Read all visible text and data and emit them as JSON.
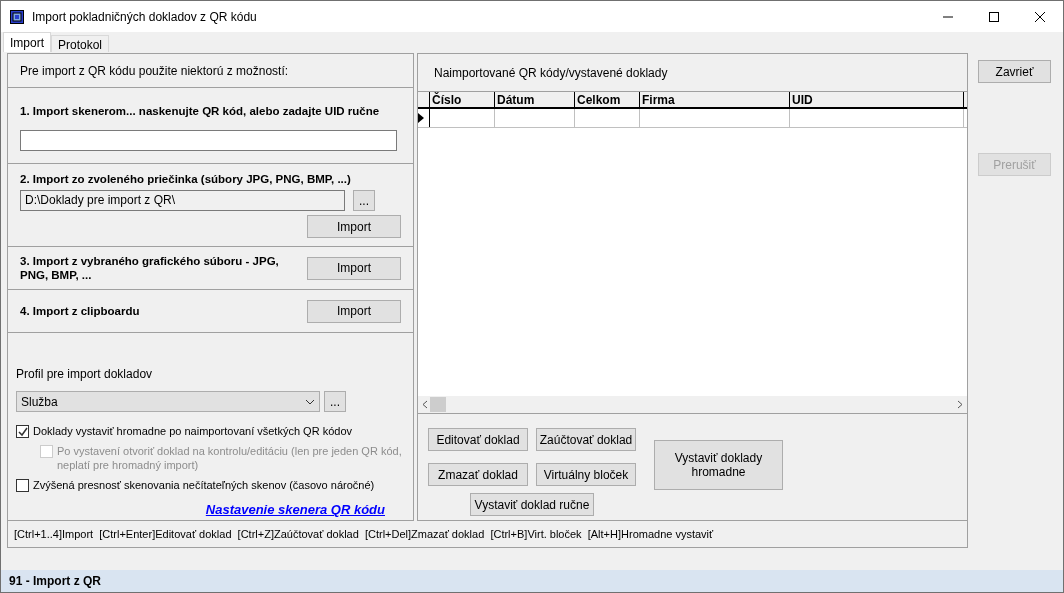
{
  "window": {
    "title": "Import pokladničných dokladov z QR kódu"
  },
  "tabs": [
    {
      "label": "Import",
      "selected": true
    },
    {
      "label": "Protokol",
      "selected": false
    }
  ],
  "left": {
    "intro": "Pre import z QR kódu použite niektorú z možností:",
    "sections": [
      {
        "kind": "field",
        "title": "1. Import skenerom... naskenujte QR kód, alebo zadajte UID ručne"
      },
      {
        "kind": "folder",
        "title": "2. Import zo zvoleného priečinka (súbory JPG, PNG, BMP, ...)",
        "value": "D:\\Doklady pre import z QR\\",
        "browse": "...",
        "button": "Import"
      },
      {
        "kind": "button",
        "title": "3. Import z vybraného grafického súboru - JPG, PNG, BMP, ...",
        "button": "Import"
      },
      {
        "kind": "button",
        "title": "4. Import z clipboardu",
        "button": "Import"
      }
    ],
    "profile_label": "Profil pre import dokladov",
    "profile_value": "Služba",
    "profile_browse": "...",
    "options": [
      {
        "label": "Doklady vystaviť hromadne po naimportovaní všetkých QR kódov",
        "checked": true,
        "disabled": false,
        "children": [
          {
            "label": "Po vystavení otvoriť doklad na kontrolu/editáciu (len pre jeden QR kód, neplatí pre hromadný import)",
            "checked": false,
            "disabled": true
          }
        ]
      },
      {
        "label": "Zvýšená presnosť skenovania nečítateľných skenov (časovo náročné)",
        "checked": false,
        "disabled": false
      }
    ],
    "link": "Nastavenie skenera QR kódu"
  },
  "right": {
    "title": "Naimportované QR kódy/vystavené doklady",
    "table": {
      "columns": [
        "Číslo",
        "Dátum",
        "Celkom",
        "Firma",
        "UID"
      ]
    },
    "buttons": [
      "Editovať doklad",
      "Zaúčtovať doklad",
      "Zmazať doklad",
      "Virtuálny bloček",
      "Vystaviť doklad ručne"
    ],
    "bulk_button": "Vystaviť doklady hromadne"
  },
  "side_buttons": [
    {
      "label": "Zavrieť",
      "disabled": false
    },
    {
      "label": "Prerušiť",
      "disabled": true
    }
  ],
  "shortcuts": "[Ctrl+1..4]Import  [Ctrl+Enter]Editovať doklad  [Ctrl+Z]Zaúčtovať doklad  [Ctrl+Del]Zmazať doklad  [Ctrl+B]Virt. bloček  [Alt+H]Hromadne vystaviť",
  "status_bar": "91 - Import z QR"
}
